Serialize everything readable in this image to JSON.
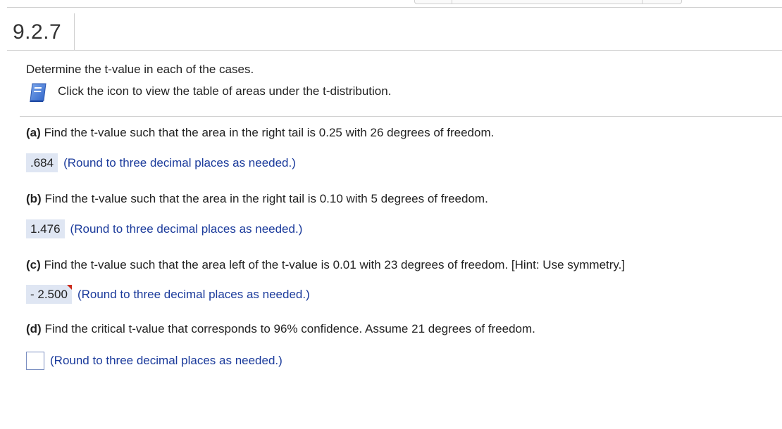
{
  "header": {
    "section_number": "9.2.7"
  },
  "intro": {
    "instruction": "Determine the t-value in each of the cases.",
    "table_link_text": "Click the icon to view the table of areas under the t-distribution.",
    "table_icon": "book-icon"
  },
  "questions": [
    {
      "label": "(a)",
      "text": "Find the t-value such that the area in the right tail is 0.25 with 26 degrees of freedom.",
      "answer": ".684",
      "hint": "(Round to three decimal places as needed.)"
    },
    {
      "label": "(b)",
      "text": "Find the t-value such that the area in the right tail is 0.10 with 5 degrees of freedom.",
      "answer": "1.476",
      "hint": "(Round to three decimal places as needed.)"
    },
    {
      "label": "(c)",
      "text": "Find the t-value such that the area left of the t-value is 0.01 with 23 degrees of freedom. [Hint: Use symmetry.]",
      "answer": "- 2.500",
      "hint": "(Round to three decimal places as needed.)"
    },
    {
      "label": "(d)",
      "text": "Find the critical t-value that corresponds to 96% confidence. Assume 21 degrees of freedom.",
      "answer": "",
      "hint": "(Round to three decimal places as needed.)"
    }
  ],
  "colors": {
    "answer_bg": "#dfe6f3",
    "hint_text": "#1a3a9b",
    "incorrect_flag": "#cc2a1a",
    "rule": "#cfcfcf"
  }
}
